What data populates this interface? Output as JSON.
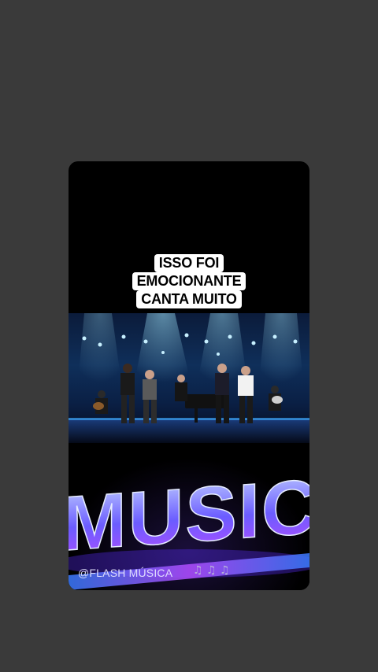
{
  "caption": {
    "lines": [
      "ISSO FOI",
      "EMOCIONANTE",
      "CANTA MUITO"
    ]
  },
  "music_sign": {
    "text": "MUSIC"
  },
  "watermark": {
    "handle": "@FLASH MÚSICA",
    "notes_glyphs": "♫ ♫ ♫"
  },
  "colors": {
    "background": "#3a3a3a",
    "card": "#000000",
    "caption_bg": "#ffffff",
    "stage_blue": "#1e6bd6",
    "sign_purple": "#7a4dff"
  }
}
